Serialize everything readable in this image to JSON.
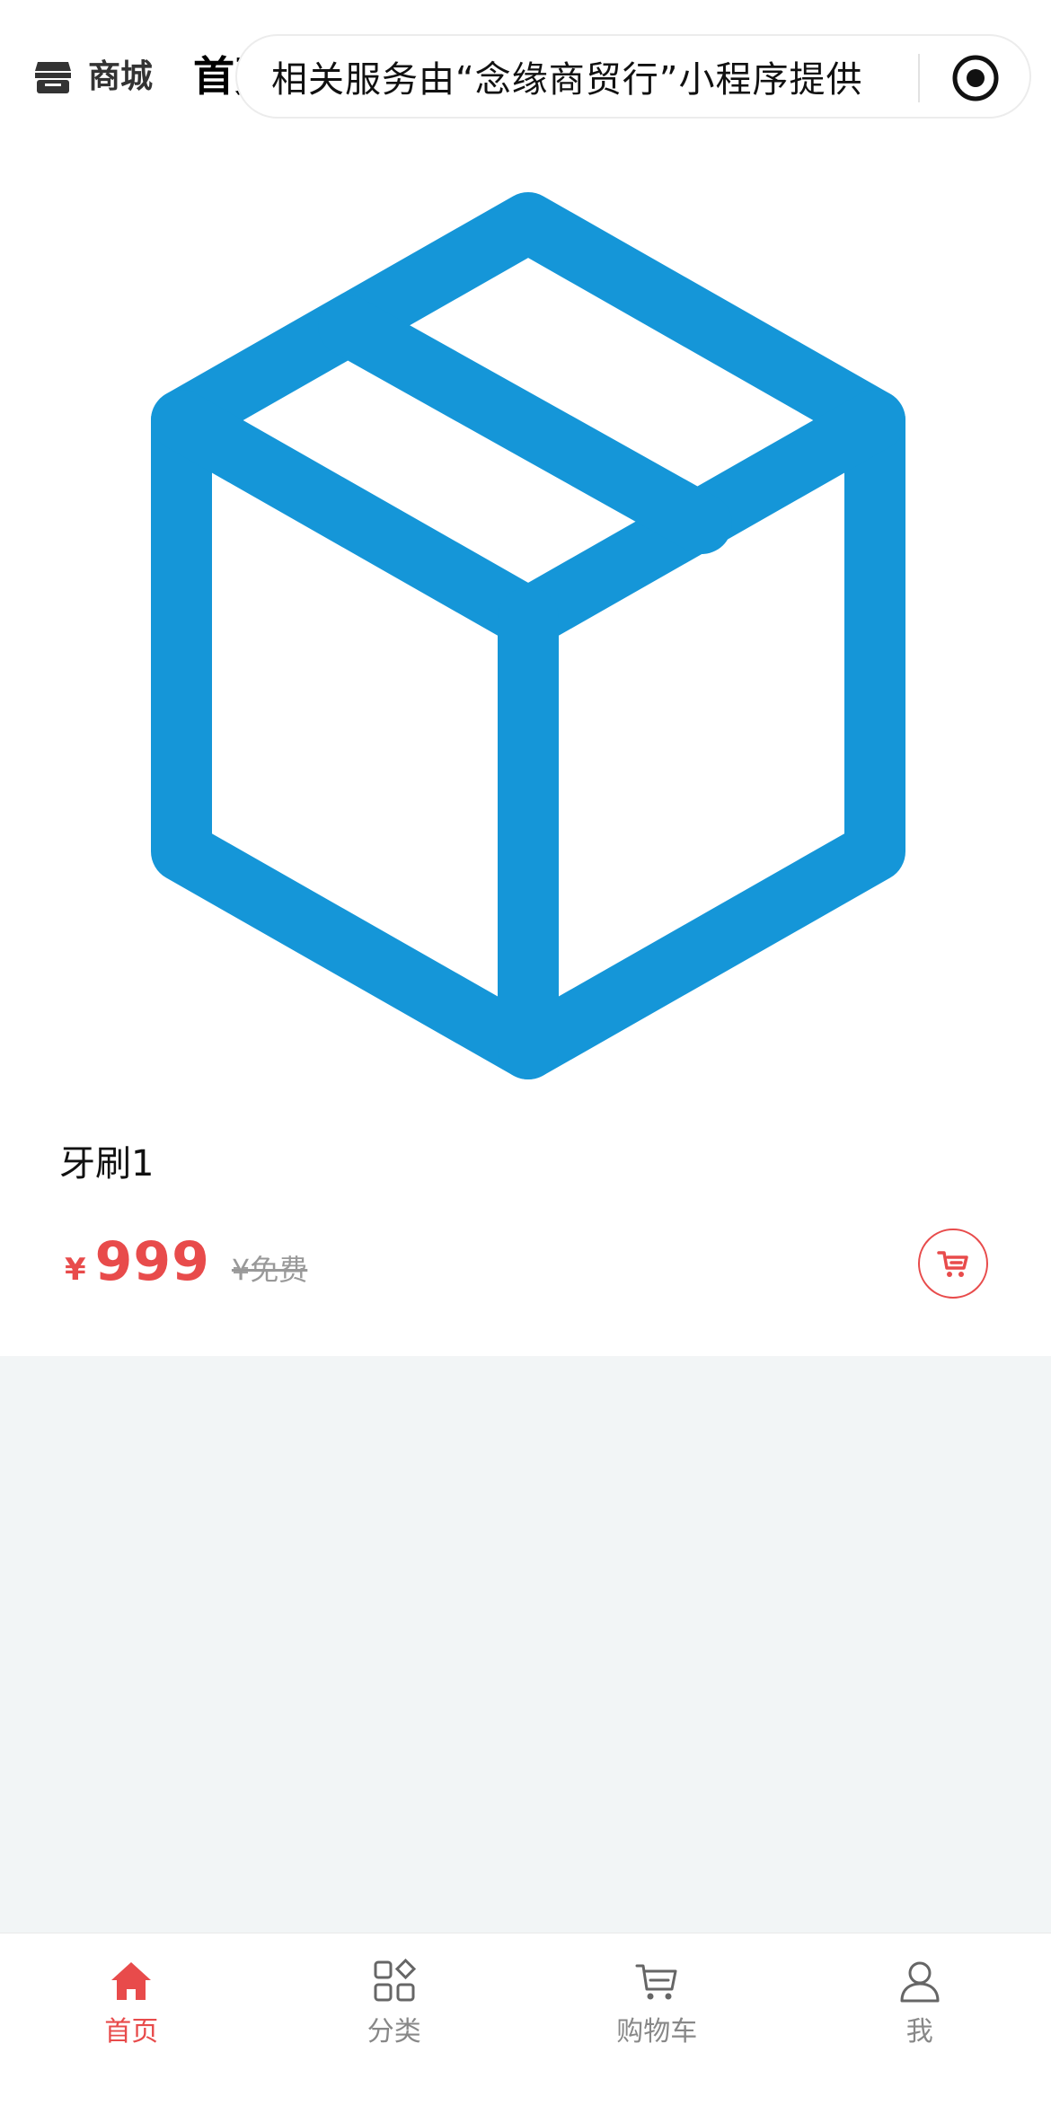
{
  "header": {
    "brand_label": "商城",
    "page_title": "首页",
    "service_notice": "相关服务由“念缘商贸行”小程序提供",
    "shop_icon": "shop-icon",
    "target_icon": "target-icon"
  },
  "product": {
    "image_icon": "box-icon",
    "name": "牙刷1",
    "currency": "¥",
    "price": "999",
    "original_price": "¥免费",
    "cart_icon": "cart-add-icon"
  },
  "tabbar": {
    "items": [
      {
        "label": "首页",
        "icon": "home-icon",
        "active": true
      },
      {
        "label": "分类",
        "icon": "category-icon",
        "active": false
      },
      {
        "label": "购物车",
        "icon": "cart-icon",
        "active": false
      },
      {
        "label": "我",
        "icon": "user-icon",
        "active": false
      }
    ]
  },
  "colors": {
    "accent": "#e84b4b",
    "box_blue": "#1596d8",
    "page_bg": "#f2f5f6",
    "text_muted": "#888888"
  }
}
